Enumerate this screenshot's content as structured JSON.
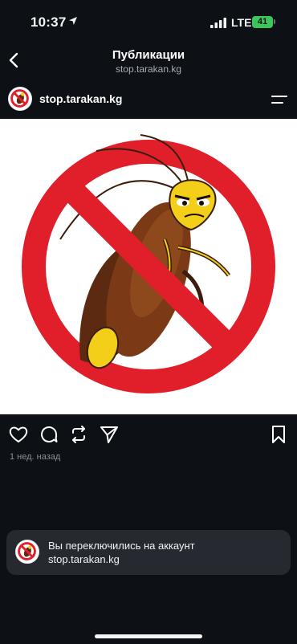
{
  "status_bar": {
    "time": "10:37",
    "network": "LTE",
    "battery": "41"
  },
  "nav": {
    "title": "Публикации",
    "subtitle": "stop.tarakan.kg"
  },
  "post": {
    "username": "stop.tarakan.kg",
    "timestamp": "1 нед. назад"
  },
  "toast": {
    "line1": "Вы переключились на аккаунт",
    "line2": "stop.tarakan.kg"
  },
  "colors": {
    "background": "#0d1116",
    "prohibition_red": "#e11f2b",
    "battery_green": "#3bc55a"
  },
  "icons": [
    "location-arrow-icon",
    "signal-icon",
    "back-chevron-icon",
    "menu-icon",
    "heart-icon",
    "comment-icon",
    "repost-icon",
    "send-icon",
    "bookmark-icon"
  ]
}
